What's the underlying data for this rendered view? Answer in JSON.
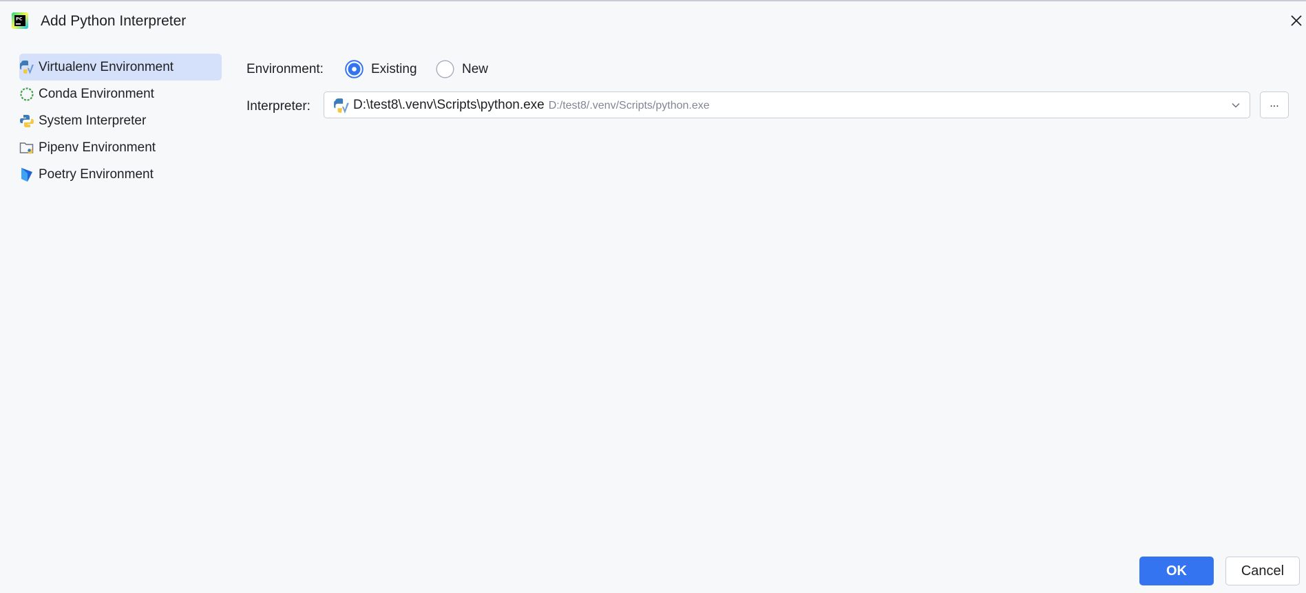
{
  "window": {
    "title": "Add Python Interpreter",
    "app_icon": "pycharm-icon",
    "close_icon": "close-icon"
  },
  "sidebar": {
    "items": [
      {
        "label": "Virtualenv Environment",
        "icon": "virtualenv-icon",
        "selected": true
      },
      {
        "label": "Conda Environment",
        "icon": "conda-icon",
        "selected": false
      },
      {
        "label": "System Interpreter",
        "icon": "python-icon",
        "selected": false
      },
      {
        "label": "Pipenv Environment",
        "icon": "pipenv-icon",
        "selected": false
      },
      {
        "label": "Poetry Environment",
        "icon": "poetry-icon",
        "selected": false
      }
    ]
  },
  "main": {
    "environment": {
      "label": "Environment:",
      "options": [
        {
          "label": "Existing",
          "selected": true
        },
        {
          "label": "New",
          "selected": false
        }
      ]
    },
    "interpreter": {
      "label": "Interpreter:",
      "value": "D:\\test8\\.venv\\Scripts\\python.exe",
      "hint": "D:/test8/.venv/Scripts/python.exe",
      "browse_label": "..."
    }
  },
  "footer": {
    "ok_label": "OK",
    "cancel_label": "Cancel"
  },
  "colors": {
    "accent": "#3574f0",
    "selected_bg": "#d5e1fb",
    "background": "#f7f8fa"
  }
}
